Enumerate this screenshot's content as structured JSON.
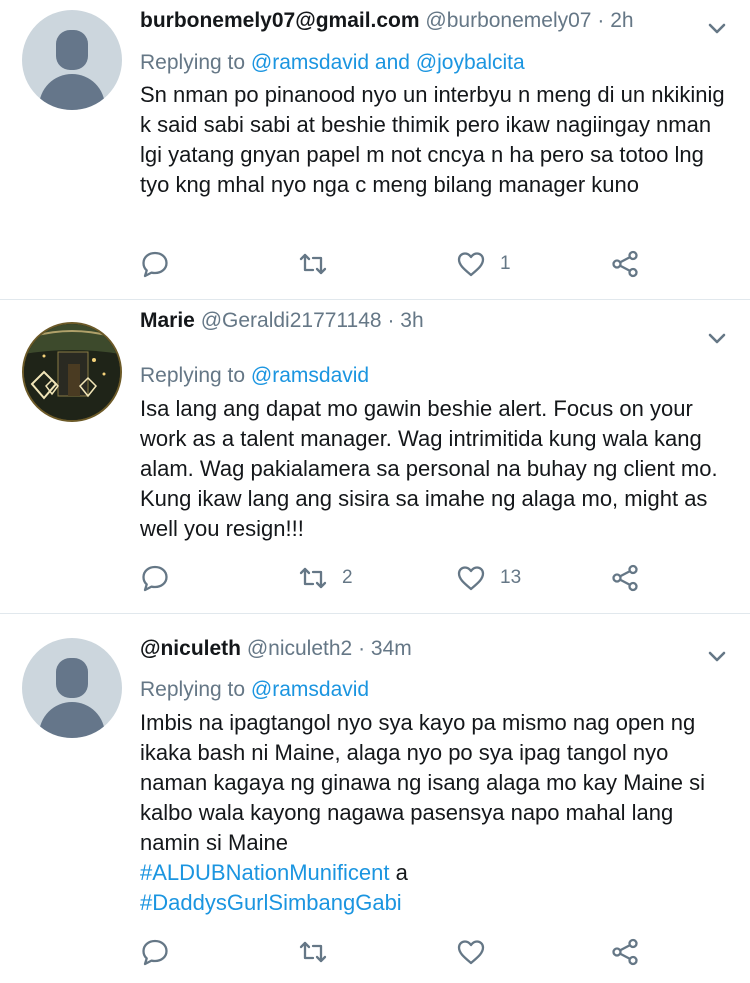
{
  "tweets": [
    {
      "name": "burbonemely07@gmail.com",
      "handle": "@burbonemely07",
      "sep": "·",
      "time": "2h",
      "replying_prefix": "Replying to",
      "replying_to": "@ramsdavid and @joybalcita",
      "body": "Sn nman po pinanood nyo un interbyu n meng di un nkikinig k said sabi sabi at beshie thimik pero ikaw nagiingay nman lgi yatang gnyan papel m not cncya n ha pero sa totoo lng tyo kng mhal nyo nga c meng bilang manager kuno",
      "replies": "",
      "retweets": "",
      "likes": "1",
      "avatar": "default-profile-icon"
    },
    {
      "name": "Marie",
      "handle": "@Geraldi21771148",
      "sep": "·",
      "time": "3h",
      "replying_prefix": "Replying to",
      "replying_to": "@ramsdavid",
      "body": "Isa lang ang dapat mo gawin beshie alert. Focus on  your work as a talent manager. Wag intrimitida kung wala kang alam. Wag pakialamera sa personal na buhay ng client mo. Kung ikaw lang ang sisira sa imahe ng alaga mo, might as well you resign!!!",
      "replies": "",
      "retweets": "2",
      "likes": "13",
      "avatar": "profile-photo"
    },
    {
      "name": "@niculeth",
      "handle": "@niculeth2",
      "sep": "·",
      "time": "34m",
      "replying_prefix": "Replying to",
      "replying_to": "@ramsdavid",
      "body": "Imbis na ipagtangol nyo sya kayo pa mismo nag open ng ikaka bash ni Maine, alaga nyo po sya ipag tangol nyo naman kagaya ng ginawa ng isang alaga mo kay Maine si kalbo wala kayong nagawa pasensya napo mahal lang namin si Maine",
      "hashtag1": "#ALDUBNationMunificent",
      "hashtag_joiner": "a",
      "hashtag2": "#DaddysGurlSimbangGabi",
      "replies": "",
      "retweets": "",
      "likes": "",
      "avatar": "default-profile-icon"
    }
  ],
  "colors": {
    "link": "#1b95e0",
    "secondary": "#657786",
    "text": "#14171a",
    "divider": "#e1e8ed"
  }
}
